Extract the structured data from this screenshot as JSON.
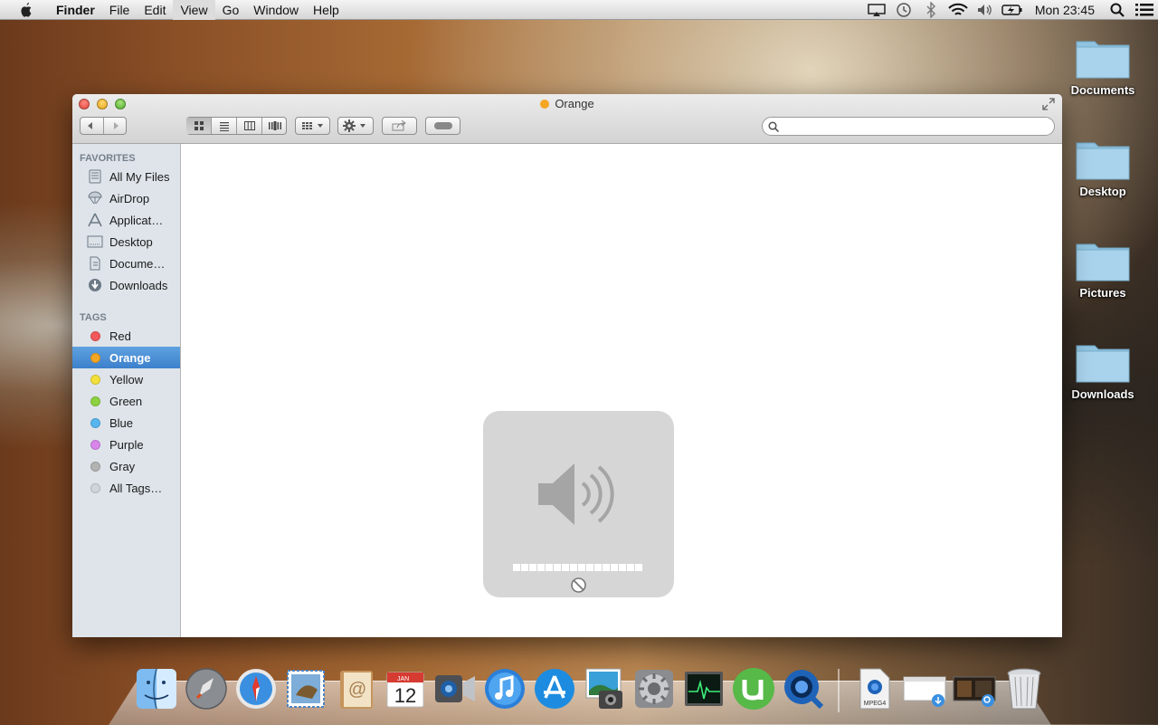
{
  "menubar": {
    "app_name": "Finder",
    "items": [
      "File",
      "Edit",
      "View",
      "Go",
      "Window",
      "Help"
    ],
    "clock": "Mon 23:45",
    "status_icons": [
      "airplay-icon",
      "time-machine-icon",
      "bluetooth-icon",
      "wifi-icon",
      "volume-icon",
      "battery-icon",
      "spotlight-icon",
      "notification-center-icon"
    ]
  },
  "window": {
    "title": "Orange",
    "title_tag_color": "#f5a623",
    "search_placeholder": ""
  },
  "sidebar": {
    "favorites_header": "FAVORITES",
    "favorites": [
      {
        "label": "All My Files",
        "icon": "all-my-files-icon"
      },
      {
        "label": "AirDrop",
        "icon": "airdrop-icon"
      },
      {
        "label": "Applicat…",
        "icon": "applications-icon"
      },
      {
        "label": "Desktop",
        "icon": "desktop-icon"
      },
      {
        "label": "Docume…",
        "icon": "documents-icon"
      },
      {
        "label": "Downloads",
        "icon": "downloads-icon"
      }
    ],
    "tags_header": "TAGS",
    "tags": [
      {
        "label": "Red",
        "color": "#f2575a"
      },
      {
        "label": "Orange",
        "color": "#f5a623"
      },
      {
        "label": "Yellow",
        "color": "#f3e03b"
      },
      {
        "label": "Green",
        "color": "#8cd240"
      },
      {
        "label": "Blue",
        "color": "#57b5ef"
      },
      {
        "label": "Purple",
        "color": "#d886ea"
      },
      {
        "label": "Gray",
        "color": "#b3b3b3"
      },
      {
        "label": "All Tags…",
        "color": "#d0d5dc"
      }
    ],
    "selected_tag": "Orange"
  },
  "volume_hud": {
    "level": 0,
    "segments": 16,
    "muted": true
  },
  "desktop_icons": [
    "Documents",
    "Desktop",
    "Pictures",
    "Downloads"
  ],
  "dock": {
    "apps": [
      "finder-icon",
      "launchpad-icon",
      "safari-icon",
      "mail-icon",
      "contacts-icon",
      "calendar-icon",
      "facetime-icon",
      "itunes-icon",
      "app-store-icon",
      "iphoto-icon",
      "system-preferences-icon",
      "activity-monitor-icon",
      "utorrent-icon",
      "quicktime-icon"
    ],
    "calendar_month": "JAN",
    "calendar_day": "12",
    "docs": [
      "mpeg4-file-icon",
      "downloads-stack-icon",
      "screenshot-stack-icon",
      "trash-icon"
    ],
    "mpeg_label": "MPEG4"
  }
}
